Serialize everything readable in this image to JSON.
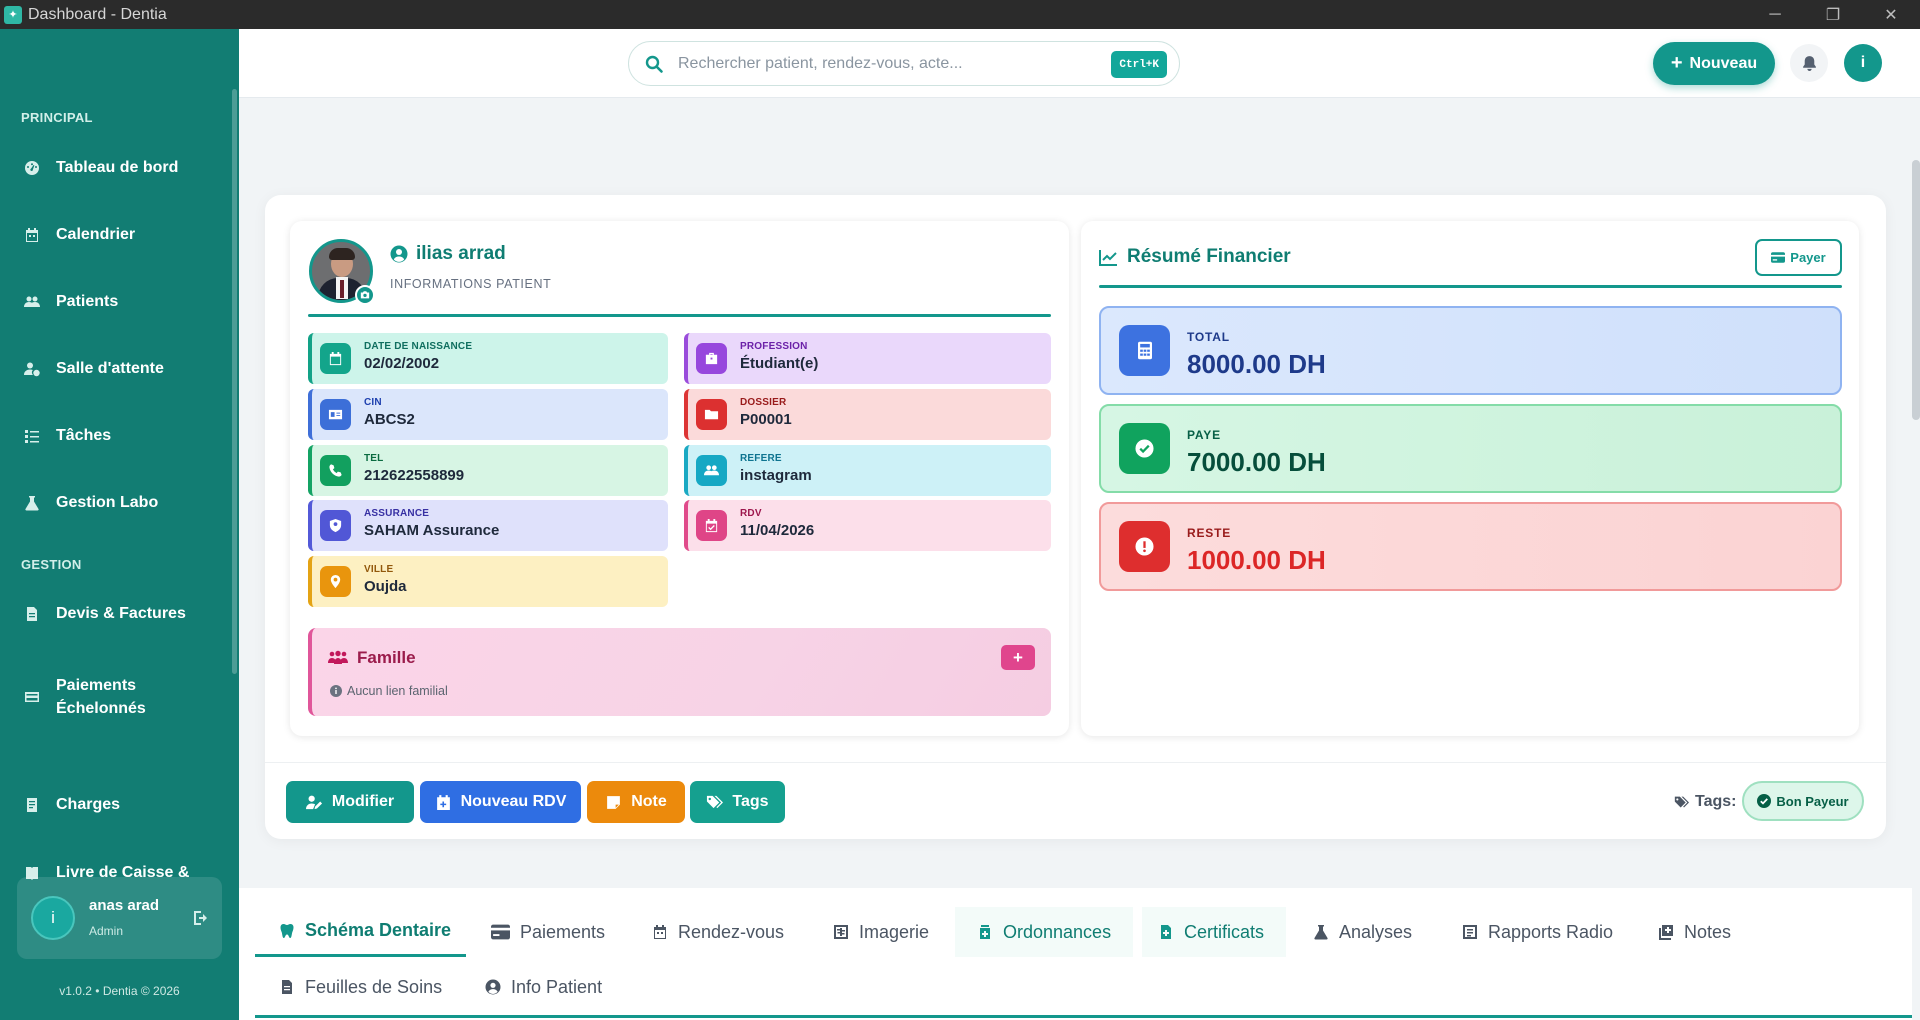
{
  "window": {
    "title": "Dashboard - Dentia"
  },
  "sidebar": {
    "section_principal": "PRINCIPAL",
    "section_gestion": "GESTION",
    "items": [
      {
        "label": "Tableau de bord",
        "icon": "dashboard-icon"
      },
      {
        "label": "Calendrier",
        "icon": "calendar-icon"
      },
      {
        "label": "Patients",
        "icon": "users-icon"
      },
      {
        "label": "Salle d'attente",
        "icon": "user-clock-icon"
      },
      {
        "label": "Tâches",
        "icon": "tasks-icon"
      },
      {
        "label": "Gestion Labo",
        "icon": "flask-icon"
      },
      {
        "label": "Devis & Factures",
        "icon": "invoice-icon"
      },
      {
        "label": "Paiements",
        "label2": "Échelonnés",
        "icon": "card-icon"
      },
      {
        "label": "Charges",
        "icon": "receipt-icon"
      },
      {
        "label": "Livre de Caisse &",
        "icon": "book-icon"
      }
    ],
    "user": {
      "initial": "i",
      "name": "anas arad",
      "role": "Admin"
    },
    "version": "v1.0.2 • Dentia © 2026"
  },
  "topbar": {
    "search_placeholder": "Rechercher patient, rendez-vous, acte...",
    "shortcut": "Ctrl+K",
    "new_button": "Nouveau",
    "avatar_initial": "i"
  },
  "patient": {
    "name": "ilias arrad",
    "subtitle": "INFORMATIONS PATIENT",
    "fields": {
      "dob": {
        "label": "DATE DE NAISSANCE",
        "value": "02/02/2002"
      },
      "profession": {
        "label": "PROFESSION",
        "value": "Étudiant(e)"
      },
      "cin": {
        "label": "CIN",
        "value": "ABCS2"
      },
      "dossier": {
        "label": "DOSSIER",
        "value": "P00001"
      },
      "tel": {
        "label": "TEL",
        "value": "212622558899"
      },
      "refere": {
        "label": "REFERE",
        "value": "instagram"
      },
      "assurance": {
        "label": "ASSURANCE",
        "value": "SAHAM Assurance"
      },
      "rdv": {
        "label": "RDV",
        "value": "11/04/2026"
      },
      "ville": {
        "label": "VILLE",
        "value": "Oujda"
      }
    },
    "famille": {
      "title": "Famille",
      "note": "Aucun lien familial",
      "add": "+"
    }
  },
  "finance": {
    "title": "Résumé Financier",
    "pay_button": "Payer",
    "total": {
      "label": "TOTAL",
      "value": "8000.00 DH"
    },
    "paye": {
      "label": "PAYE",
      "value": "7000.00 DH"
    },
    "reste": {
      "label": "RESTE",
      "value": "1000.00 DH"
    }
  },
  "actions": {
    "modifier": "Modifier",
    "nouveau_rdv": "Nouveau RDV",
    "note": "Note",
    "tags": "Tags",
    "tags_label": "Tags:",
    "tag_pill": "Bon Payeur"
  },
  "tabs": [
    "Schéma Dentaire",
    "Paiements",
    "Rendez-vous",
    "Imagerie",
    "Ordonnances",
    "Certificats",
    "Analyses",
    "Rapports Radio",
    "Notes",
    "Feuilles de Soins",
    "Info Patient"
  ],
  "colors": {
    "primary": "#13978c",
    "sidebar": "#127d73",
    "danger": "#dc2626",
    "success": "#059669"
  }
}
